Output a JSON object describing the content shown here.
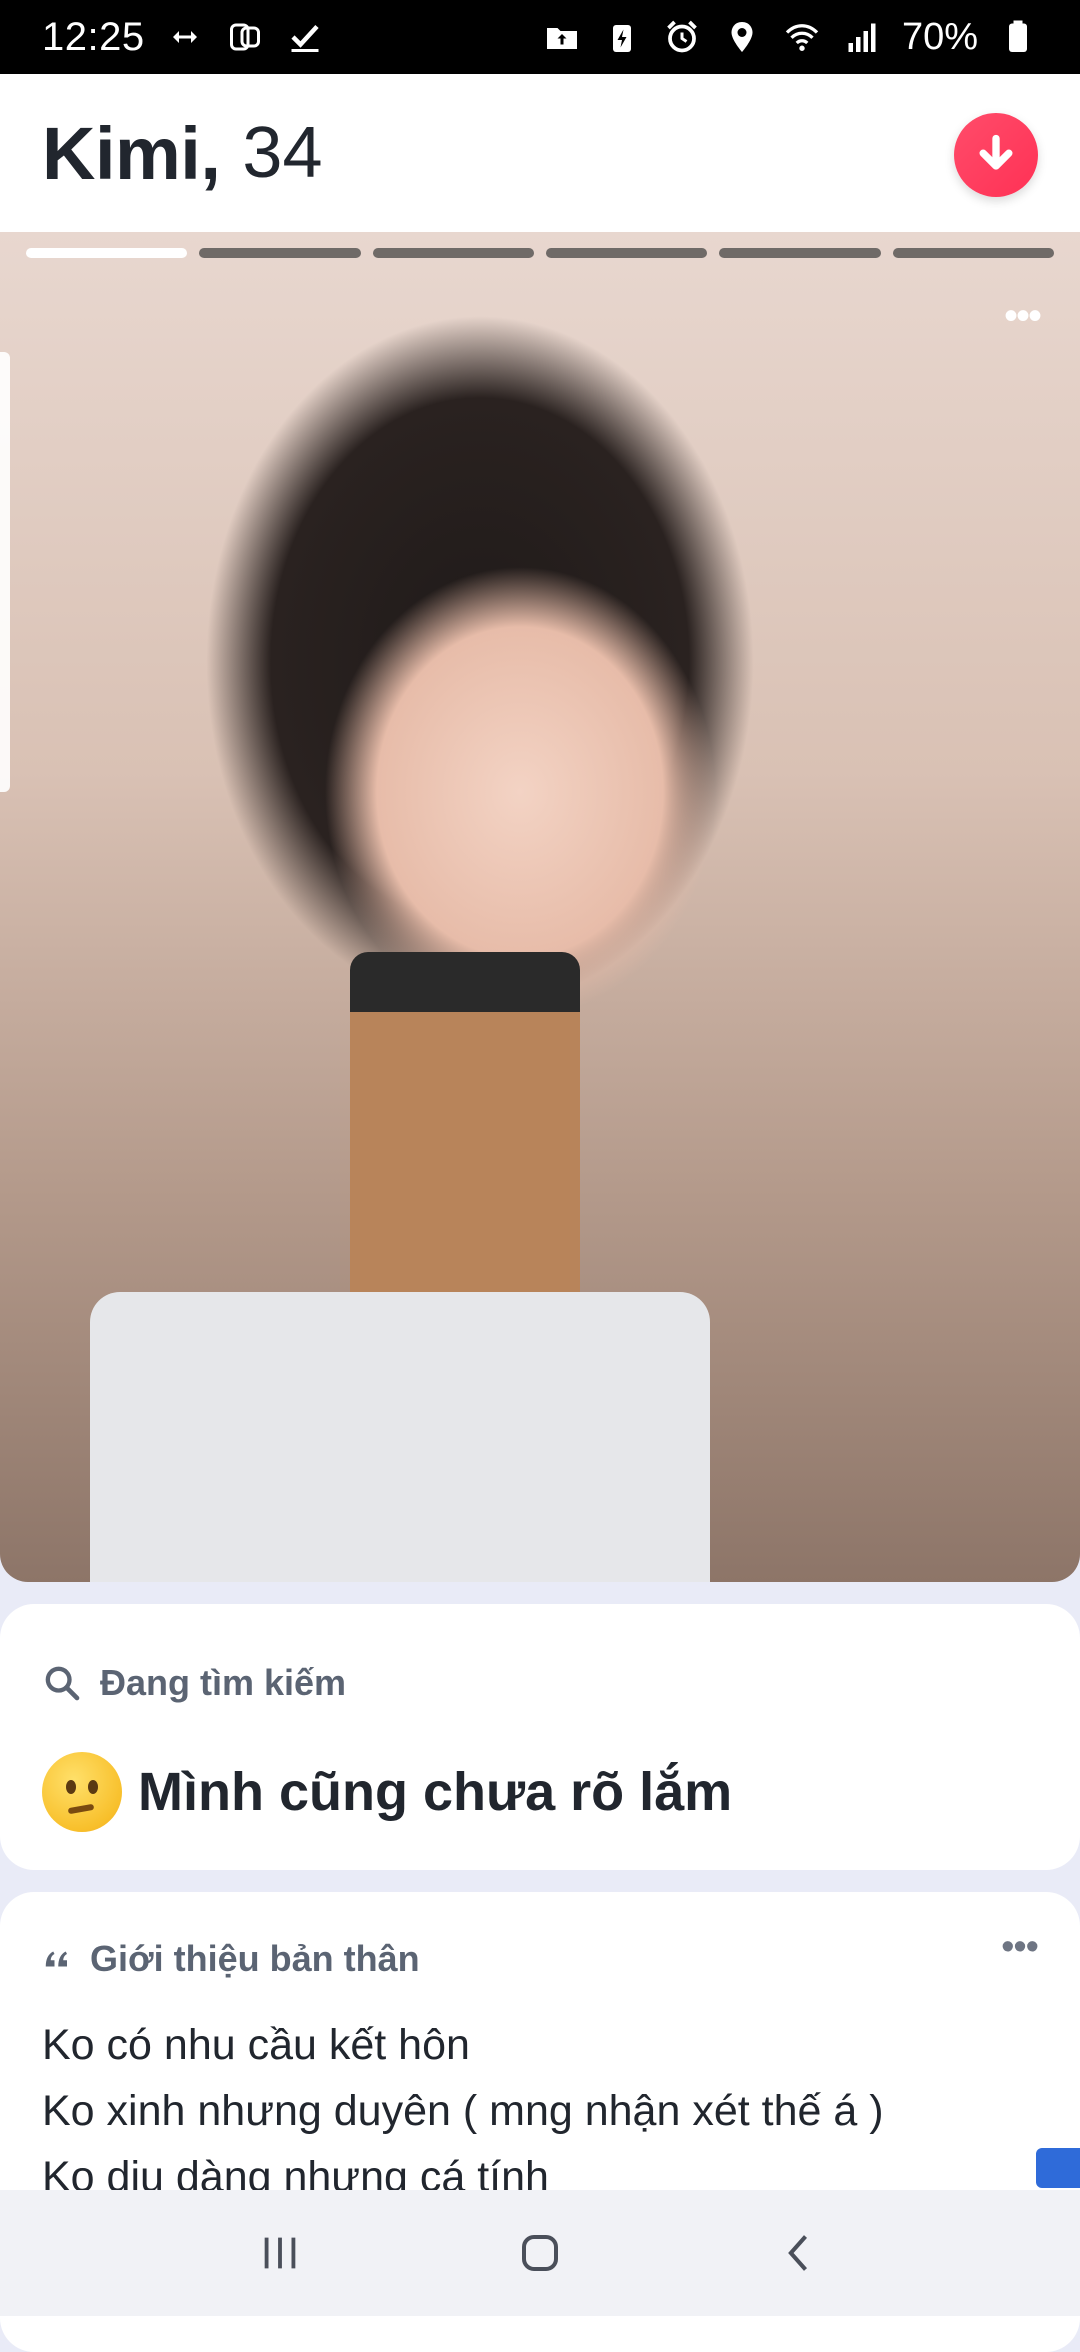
{
  "status_bar": {
    "time": "12:25",
    "battery": "70%",
    "left_icons": [
      "data-transfer-icon",
      "flipboard-icon",
      "checkbox-icon"
    ],
    "right_icons": [
      "folder-upload-icon",
      "battery-saver-icon",
      "alarm-icon",
      "location-icon",
      "wifi-icon",
      "signal-icon",
      "battery-icon"
    ]
  },
  "profile": {
    "name": "Kimi,",
    "age": "34"
  },
  "photo": {
    "total": 6,
    "active_index": 0
  },
  "looking_for": {
    "label": "Đang tìm kiếm",
    "value": "Mình cũng chưa rõ lắm",
    "emoji": "thinking-face"
  },
  "about": {
    "label": "Giới thiệu bản thân",
    "lines": [
      "Ko có nhu cầu kết hôn",
      "Ko xinh nhưng duyên ( mng nhận xét thế á )",
      "Ko dịu dàng nhưng cá tính"
    ]
  },
  "colors": {
    "accent": "#ff3d5f",
    "text": "#21262e",
    "muted": "#5b6473",
    "background": "#e9ebf7"
  }
}
